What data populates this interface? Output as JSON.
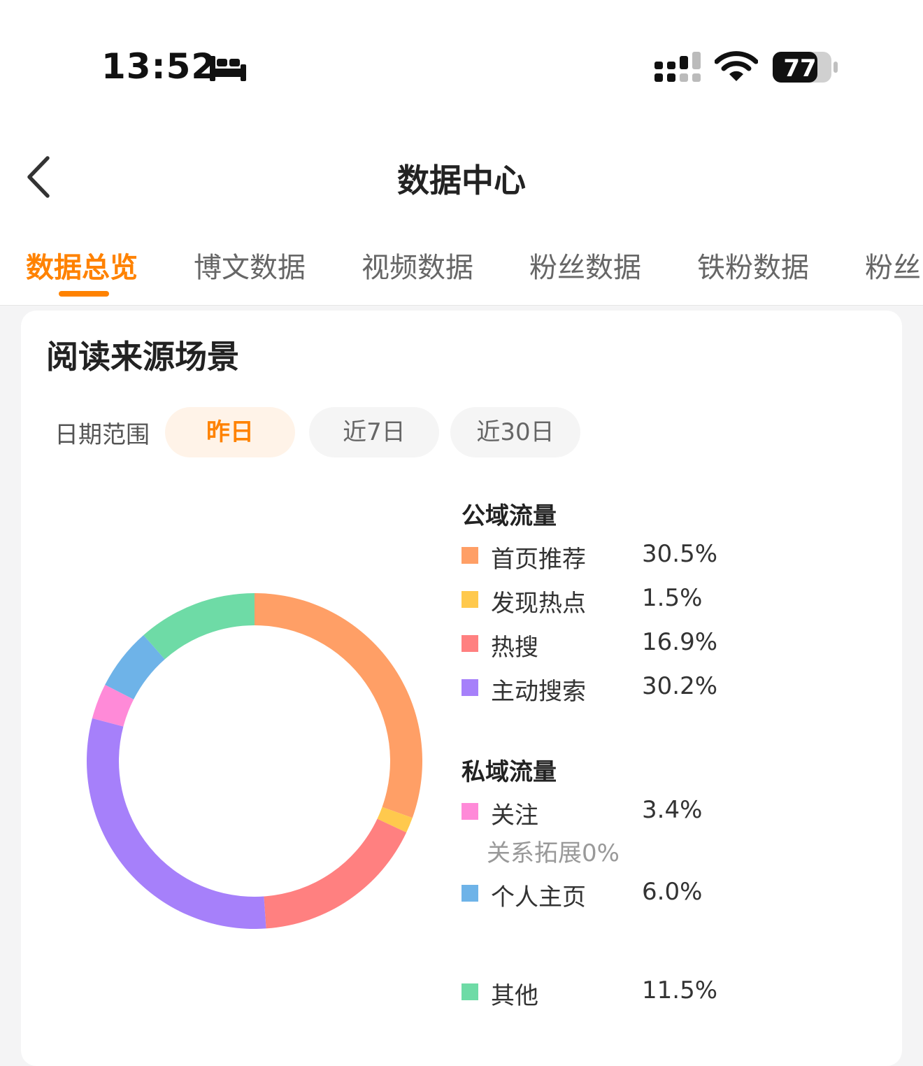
{
  "status_bar": {
    "time": "13:52",
    "battery": "77"
  },
  "header": {
    "title": "数据中心"
  },
  "tabs": [
    {
      "label": "数据总览",
      "active": true
    },
    {
      "label": "博文数据"
    },
    {
      "label": "视频数据"
    },
    {
      "label": "粉丝数据"
    },
    {
      "label": "铁粉数据"
    },
    {
      "label": "粉丝"
    }
  ],
  "card": {
    "title": "阅读来源场景",
    "date_range_label": "日期范围",
    "ranges": [
      {
        "label": "昨日",
        "active": true
      },
      {
        "label": "近7日"
      },
      {
        "label": "近30日"
      }
    ]
  },
  "legend": {
    "public_title": "公域流量",
    "private_title": "私域流量",
    "relation_note": "关系拓展0%"
  },
  "chart_data": {
    "type": "pie",
    "donut": true,
    "slices": [
      {
        "label": "首页推荐",
        "value": 30.5,
        "display": "30.5%",
        "color": "#ff9f66",
        "group": "公域流量"
      },
      {
        "label": "发现热点",
        "value": 1.5,
        "display": "1.5%",
        "color": "#ffc94d",
        "group": "公域流量"
      },
      {
        "label": "热搜",
        "value": 16.9,
        "display": "16.9%",
        "color": "#ff8080",
        "group": "公域流量"
      },
      {
        "label": "主动搜索",
        "value": 30.2,
        "display": "30.2%",
        "color": "#a680fa",
        "group": "公域流量"
      },
      {
        "label": "关注",
        "value": 3.4,
        "display": "3.4%",
        "color": "#ff8ad8",
        "group": "私域流量"
      },
      {
        "label": "个人主页",
        "value": 6.0,
        "display": "6.0%",
        "color": "#6eb3e8",
        "group": "私域流量"
      },
      {
        "label": "其他",
        "value": 11.5,
        "display": "11.5%",
        "color": "#6edba6",
        "group": ""
      }
    ]
  }
}
